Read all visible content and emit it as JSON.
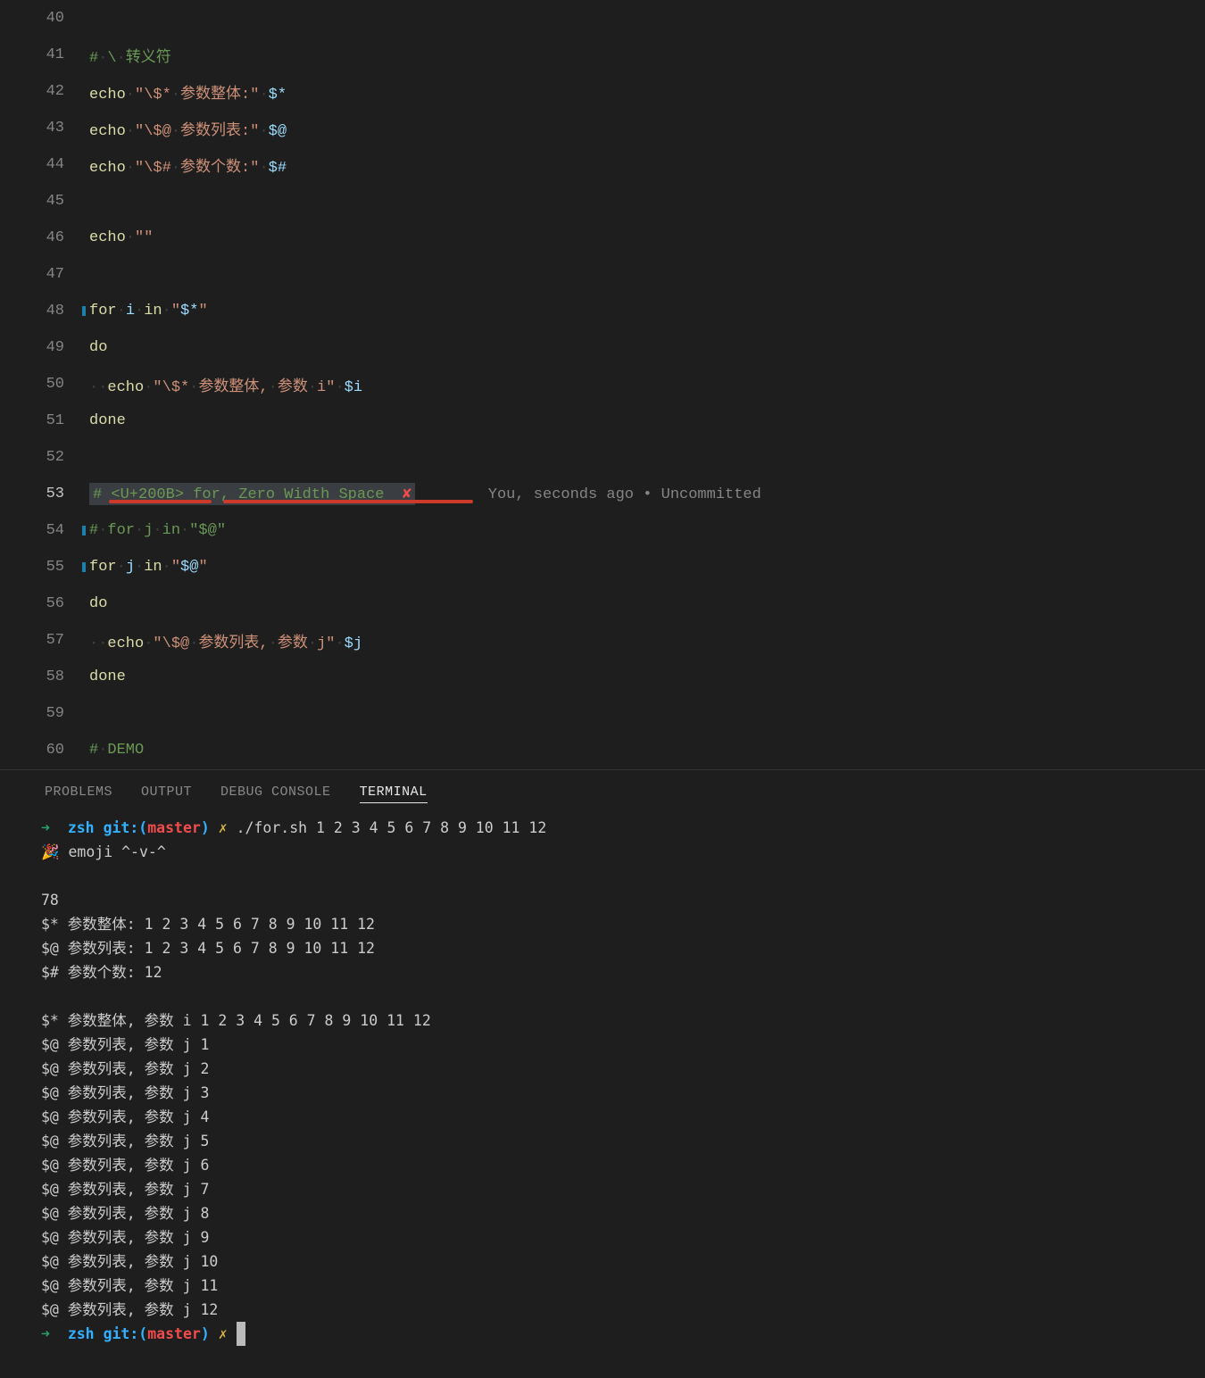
{
  "lines": [
    {
      "num": "40",
      "html": ""
    },
    {
      "num": "41",
      "html": "<span class='comment'>#</span><span class='ws'>·</span><span class='comment'>\\</span><span class='ws'>·</span><span class='comment'>转义符</span>"
    },
    {
      "num": "42",
      "html": "<span class='keyword'>echo</span><span class='ws'>·</span><span class='string'>\"\\$*</span><span class='ws'>·</span><span class='string'>参数整体:\"</span><span class='ws'>·</span><span class='variable'>$*</span>"
    },
    {
      "num": "43",
      "html": "<span class='keyword'>echo</span><span class='ws'>·</span><span class='string'>\"\\$@</span><span class='ws'>·</span><span class='string'>参数列表:\"</span><span class='ws'>·</span><span class='variable'>$@</span>"
    },
    {
      "num": "44",
      "html": "<span class='keyword'>echo</span><span class='ws'>·</span><span class='string'>\"\\$#</span><span class='ws'>·</span><span class='string'>参数个数:\"</span><span class='ws'>·</span><span class='variable'>$#</span>"
    },
    {
      "num": "45",
      "html": ""
    },
    {
      "num": "46",
      "html": "<span class='keyword'>echo</span><span class='ws'>·</span><span class='string'>\"\"</span>"
    },
    {
      "num": "47",
      "html": ""
    },
    {
      "num": "48",
      "mod": true,
      "html": "<span class='keyword'>for</span><span class='ws'>·</span><span class='variable'>i</span><span class='ws'>·</span><span class='keyword'>in</span><span class='ws'>·</span><span class='string'>\"</span><span class='variable'>$*</span><span class='string'>\"</span>"
    },
    {
      "num": "49",
      "html": "<span class='keyword'>do</span>"
    },
    {
      "num": "50",
      "html": "<span class='ws'>··</span><span class='keyword'>echo</span><span class='ws'>·</span><span class='string'>\"\\$*</span><span class='ws'>·</span><span class='string'>参数整体,</span><span class='ws'>·</span><span class='string'>参数</span><span class='ws'>·</span><span class='string'>i\"</span><span class='ws'>·</span><span class='variable'>$i</span>"
    },
    {
      "num": "51",
      "html": "<span class='keyword'>done</span>"
    },
    {
      "num": "52",
      "html": ""
    },
    {
      "num": "53",
      "active": true,
      "highlight": true,
      "html": "<span class='code-inner'><span class='comment'>#</span><span class='ws'>·</span><span class='comment'>&lt;U+200B&gt;</span><span class='ws'>·</span><span class='comment'>for,</span><span class='ws'>·</span><span class='comment'>Zero</span><span class='ws'>·</span><span class='comment'>Width</span><span class='ws'>·</span><span class='comment'>Space</span>  <span class='err-icon'>✘</span></span>        <span class='codelens'>You, seconds ago • Uncommitted</span>",
      "underline": true
    },
    {
      "num": "54",
      "mod": true,
      "html": "<span class='comment'>#</span><span class='ws'>·</span><span class='comment'>for</span><span class='ws'>·</span><span class='comment'>j</span><span class='ws'>·</span><span class='comment'>in</span><span class='ws'>·</span><span class='comment'>\"$@\"</span>"
    },
    {
      "num": "55",
      "mod": true,
      "html": "<span class='keyword'>for</span><span class='ws'>·</span><span class='variable'>j</span><span class='ws'>·</span><span class='keyword'>in</span><span class='ws'>·</span><span class='string'>\"</span><span class='variable'>$@</span><span class='string'>\"</span>"
    },
    {
      "num": "56",
      "html": "<span class='keyword'>do</span>"
    },
    {
      "num": "57",
      "html": "<span class='ws'>··</span><span class='keyword'>echo</span><span class='ws'>·</span><span class='string'>\"\\$@</span><span class='ws'>·</span><span class='string'>参数列表,</span><span class='ws'>·</span><span class='string'>参数</span><span class='ws'>·</span><span class='string'>j\"</span><span class='ws'>·</span><span class='variable'>$j</span>"
    },
    {
      "num": "58",
      "html": "<span class='keyword'>done</span>"
    },
    {
      "num": "59",
      "html": ""
    },
    {
      "num": "60",
      "html": "<span class='comment'>#</span><span class='ws'>·</span><span class='comment'>DEMO</span>"
    }
  ],
  "panel_tabs": {
    "problems": "PROBLEMS",
    "output": "OUTPUT",
    "debug": "DEBUG CONSOLE",
    "terminal": "TERMINAL"
  },
  "terminal": {
    "prompt_arrow": "➜",
    "prompt_zsh": "zsh",
    "prompt_git": "git:",
    "prompt_branch": "master",
    "prompt_x": "✗",
    "command": "./for.sh 1 2 3 4 5 6 7 8 9 10 11 12",
    "emoji_line": "🎉 emoji ^-v-^",
    "out": [
      "",
      "78",
      "$* 参数整体: 1 2 3 4 5 6 7 8 9 10 11 12",
      "$@ 参数列表: 1 2 3 4 5 6 7 8 9 10 11 12",
      "$# 参数个数: 12",
      "",
      "$* 参数整体, 参数 i 1 2 3 4 5 6 7 8 9 10 11 12",
      "$@ 参数列表, 参数 j 1",
      "$@ 参数列表, 参数 j 2",
      "$@ 参数列表, 参数 j 3",
      "$@ 参数列表, 参数 j 4",
      "$@ 参数列表, 参数 j 5",
      "$@ 参数列表, 参数 j 6",
      "$@ 参数列表, 参数 j 7",
      "$@ 参数列表, 参数 j 8",
      "$@ 参数列表, 参数 j 9",
      "$@ 参数列表, 参数 j 10",
      "$@ 参数列表, 参数 j 11",
      "$@ 参数列表, 参数 j 12"
    ]
  }
}
